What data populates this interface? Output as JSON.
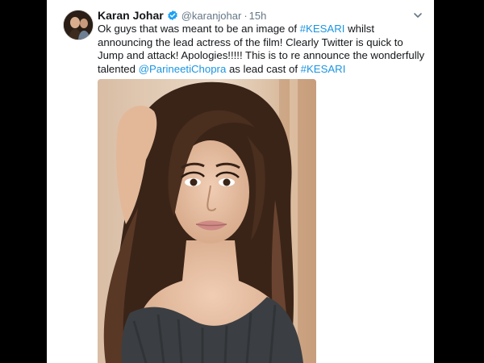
{
  "tweet": {
    "author": {
      "display_name": "Karan Johar",
      "handle": "@karanjohar",
      "verified": true
    },
    "separator": "·",
    "time": "15h",
    "text": {
      "part1": "Ok guys that was meant to be an image of ",
      "hashtag1": "#KESARI",
      "part2": " whilst announcing the lead actress of the film! Clearly Twitter is quick to Jump and attack! Apologies!!!!! This is to re announce the wonderfully talented ",
      "mention": "@ParineetiChopra",
      "part3": " as lead cast of ",
      "hashtag2": "#KESARI"
    },
    "colors": {
      "link": "#1b95e0",
      "text": "#14171a",
      "meta": "#657786"
    },
    "icons": {
      "verified": "verified-badge-icon",
      "menu": "chevron-down-icon"
    }
  }
}
